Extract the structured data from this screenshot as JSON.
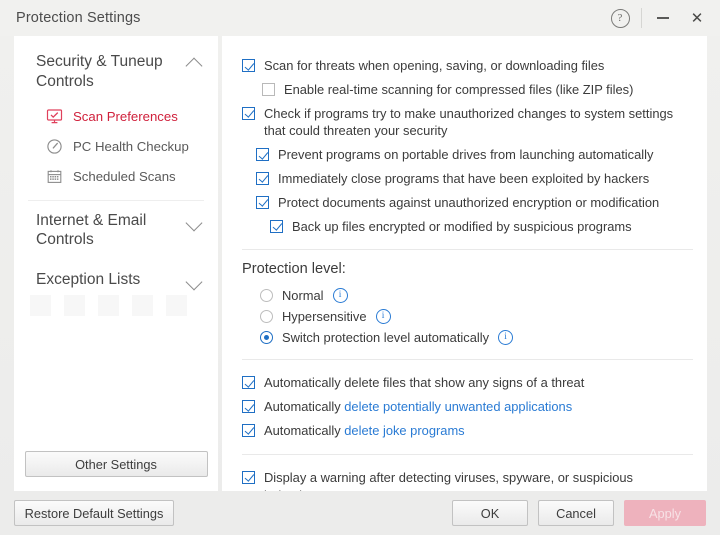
{
  "window": {
    "title": "Protection Settings",
    "help_icon": "help-icon",
    "minimize_icon": "minimize-icon",
    "close_icon": "close-icon",
    "close_glyph": "✕",
    "help_glyph": "?"
  },
  "sidebar": {
    "groups": [
      {
        "label": "Security & Tuneup Controls",
        "expanded": true,
        "chevron": "chevron-up-icon",
        "items": [
          {
            "label": "Scan Preferences",
            "icon": "monitor-check-icon",
            "active": true
          },
          {
            "label": "PC Health Checkup",
            "icon": "speedometer-icon",
            "active": false
          },
          {
            "label": "Scheduled Scans",
            "icon": "calendar-icon",
            "active": false
          }
        ]
      },
      {
        "label": "Internet & Email Controls",
        "expanded": false,
        "chevron": "chevron-down-icon",
        "items": []
      },
      {
        "label": "Exception Lists",
        "expanded": false,
        "chevron": "chevron-down-icon",
        "items": []
      }
    ],
    "other_settings_label": "Other Settings"
  },
  "main": {
    "top_options": [
      {
        "label": "Scan for threats when opening, saving, or downloading files",
        "checked": true,
        "indent": 0
      },
      {
        "label": "Enable real-time scanning for compressed files (like ZIP files)",
        "checked": false,
        "indent": 1
      },
      {
        "label": "Check if programs try to make unauthorized changes to system settings that could threaten your security",
        "checked": true,
        "indent": 0
      },
      {
        "label": "Prevent programs on portable drives from launching automatically",
        "checked": true,
        "indent": 2
      },
      {
        "label": "Immediately close programs that have been exploited by hackers",
        "checked": true,
        "indent": 2
      },
      {
        "label": "Protect documents against unauthorized encryption or modification",
        "checked": true,
        "indent": 2
      },
      {
        "label": "Back up files encrypted or modified by suspicious programs",
        "checked": true,
        "indent": 3
      }
    ],
    "protection_level": {
      "title": "Protection level:",
      "info_glyph": "i",
      "options": [
        {
          "label": "Normal",
          "selected": false,
          "info": true
        },
        {
          "label": "Hypersensitive",
          "selected": false,
          "info": true
        },
        {
          "label": "Switch protection level automatically",
          "selected": true,
          "info": true
        }
      ]
    },
    "auto_delete_options": [
      {
        "prefix": "Automatically delete files that show any signs of a threat",
        "link": "",
        "checked": true
      },
      {
        "prefix": "Automatically ",
        "link": "delete potentially unwanted applications",
        "checked": true
      },
      {
        "prefix": "Automatically ",
        "link": "delete joke programs",
        "checked": true
      }
    ],
    "warning_option": {
      "label": "Display a warning after detecting viruses, spyware, or suspicious behavior",
      "checked": true
    }
  },
  "footer": {
    "restore_label": "Restore Default Settings",
    "ok_label": "OK",
    "cancel_label": "Cancel",
    "apply_label": "Apply"
  },
  "colors": {
    "accent_red": "#e01b3c",
    "checkbox_blue": "#1f6fc4",
    "link_blue": "#2a7bd4",
    "apply_pink": "#eeb2bd"
  }
}
